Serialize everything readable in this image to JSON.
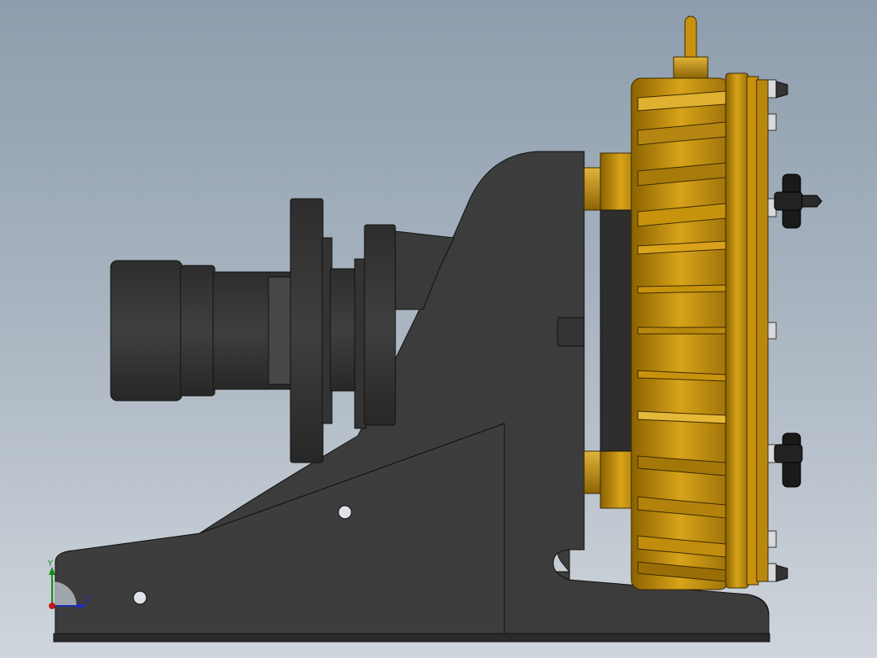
{
  "viewport": {
    "background_top": "#8e9dad",
    "background_bottom": "#cfd5dc"
  },
  "model": {
    "frame_color": "#3b3b3b",
    "pump_color": "#c8930c",
    "knob_color": "#111111",
    "hardware_color": "#d9d9d9"
  },
  "triad": {
    "y_label": "Y",
    "z_label": "Z",
    "y_color": "#1a8a1a",
    "z_color": "#1e2fb5",
    "x_color": "#c41818"
  }
}
